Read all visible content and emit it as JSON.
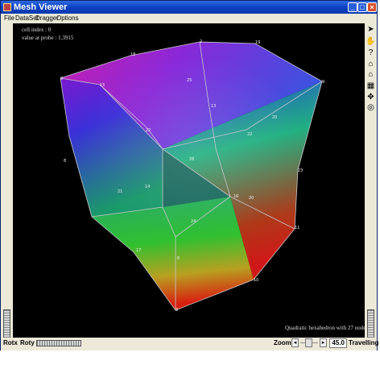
{
  "window": {
    "title": "Mesh Viewer",
    "title_icon": "mesh-app-icon"
  },
  "titlebar_buttons": {
    "minimize": "_",
    "maximize": "□",
    "close": "×"
  },
  "menu": [
    "File",
    "DataSet",
    "Dragger",
    "Options"
  ],
  "overlay": {
    "cell_index": "cell index : 0",
    "value_at_probe": "value at probe : 1.3915",
    "caption": "Quadratic hexahedron with 27 nodes"
  },
  "tools": [
    "pointer-arrow-icon",
    "hand-view-icon",
    "help-question-icon",
    "home-icon",
    "set-home-icon",
    "view-all-icon",
    "seek-icon",
    "projection-icon"
  ],
  "tool_glyphs": [
    "➤",
    "✋",
    "?",
    "⌂",
    "⌂",
    "▦",
    "✥",
    "◎"
  ],
  "bottombar": {
    "rotx_label": "Rotx",
    "roty_label": "Roty",
    "zoom_label": "Zoom",
    "zoom_left": "◂",
    "zoom_right": "▸",
    "zoom_value": "45.0",
    "travelling_label": "Travelling"
  },
  "mesh_nodes": [
    {
      "label": "0"
    },
    {
      "label": "18"
    },
    {
      "label": "2"
    },
    {
      "label": "19"
    },
    {
      "label": "9"
    },
    {
      "label": "25"
    },
    {
      "label": "13"
    },
    {
      "label": "15"
    },
    {
      "label": "22"
    },
    {
      "label": "22"
    },
    {
      "label": "20"
    },
    {
      "label": "26"
    },
    {
      "label": "8"
    },
    {
      "label": "21"
    },
    {
      "label": "14"
    },
    {
      "label": "23"
    },
    {
      "label": "20"
    },
    {
      "label": "16"
    },
    {
      "label": "24"
    },
    {
      "label": "11"
    },
    {
      "label": "17"
    },
    {
      "label": "6"
    },
    {
      "label": "10"
    },
    {
      "label": "3"
    }
  ],
  "colors": {
    "background": "#000000",
    "edge": "#c8c8d0",
    "blue": "#3a3ae0",
    "magenta": "#c020b0",
    "green": "#20c040",
    "red": "#e02020"
  }
}
